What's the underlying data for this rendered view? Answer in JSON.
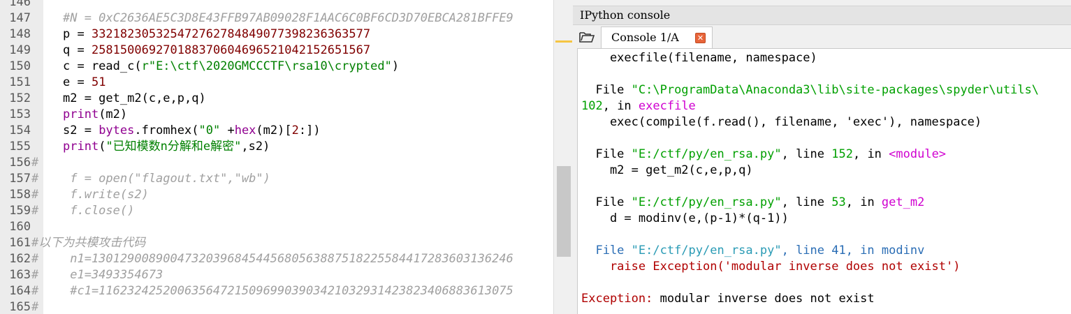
{
  "editor": {
    "lines": [
      {
        "num": "146",
        "fold": "",
        "tokens": []
      },
      {
        "num": "147",
        "fold": "",
        "tokens": [
          {
            "t": "#N = 0xC2636AE5C3D8E43FFB97AB09028F1AAC6C0BF6CD3D70EBCA281BFFE9",
            "c": "cmt"
          }
        ]
      },
      {
        "num": "148",
        "fold": "",
        "tokens": [
          {
            "t": "p = ",
            "c": "var"
          },
          {
            "t": "33218230532547276278484907739823636357​7",
            "c": "num"
          }
        ]
      },
      {
        "num": "149",
        "fold": "",
        "tokens": [
          {
            "t": "q = ",
            "c": "var"
          },
          {
            "t": "258150069270188370604696521042152651567",
            "c": "num"
          }
        ]
      },
      {
        "num": "150",
        "fold": "",
        "tokens": [
          {
            "t": "c = read_c(",
            "c": "var"
          },
          {
            "t": "r\"E:\\ctf\\2020GMCCCTF\\rsa10\\crypted\"",
            "c": "str"
          },
          {
            "t": ")",
            "c": "var"
          }
        ]
      },
      {
        "num": "151",
        "fold": "",
        "tokens": [
          {
            "t": "e = ",
            "c": "var"
          },
          {
            "t": "51",
            "c": "num"
          }
        ]
      },
      {
        "num": "152",
        "fold": "",
        "tokens": [
          {
            "t": "m2 = get_m2(c,e,p,q)",
            "c": "var"
          }
        ]
      },
      {
        "num": "153",
        "fold": "",
        "tokens": [
          {
            "t": "print",
            "c": "kw"
          },
          {
            "t": "(m2)",
            "c": "var"
          }
        ]
      },
      {
        "num": "154",
        "fold": "",
        "tokens": [
          {
            "t": "s2 = ",
            "c": "var"
          },
          {
            "t": "bytes",
            "c": "kw"
          },
          {
            "t": ".fromhex(",
            "c": "var"
          },
          {
            "t": "\"0\"",
            "c": "str"
          },
          {
            "t": " +",
            "c": "var"
          },
          {
            "t": "hex",
            "c": "kw"
          },
          {
            "t": "(m2)[",
            "c": "var"
          },
          {
            "t": "2",
            "c": "num"
          },
          {
            "t": ":])",
            "c": "var"
          }
        ]
      },
      {
        "num": "155",
        "fold": "",
        "tokens": [
          {
            "t": "print",
            "c": "kw"
          },
          {
            "t": "(",
            "c": "var"
          },
          {
            "t": "\"已知模数n分解和e解密\"",
            "c": "str"
          },
          {
            "t": ",s2)",
            "c": "var"
          }
        ]
      },
      {
        "num": "156",
        "fold": "#",
        "tokens": []
      },
      {
        "num": "157",
        "fold": "#",
        "tokens": [
          {
            "t": " f = open(\"flagout.txt\",\"wb\")",
            "c": "cmt"
          }
        ]
      },
      {
        "num": "158",
        "fold": "#",
        "tokens": [
          {
            "t": " f.write(s2)",
            "c": "cmt"
          }
        ]
      },
      {
        "num": "159",
        "fold": "#",
        "tokens": [
          {
            "t": " f.close()",
            "c": "cmt"
          }
        ]
      },
      {
        "num": "160",
        "fold": "",
        "tokens": []
      },
      {
        "num": "161",
        "fold": "#以下为共模攻击代码",
        "tokens": []
      },
      {
        "num": "162",
        "fold": "#",
        "tokens": [
          {
            "t": " n1=1301290089004732039684544568056388751822558441728360313624​6",
            "c": "cmt"
          }
        ]
      },
      {
        "num": "163",
        "fold": "#",
        "tokens": [
          {
            "t": " e1=3493354673",
            "c": "cmt"
          }
        ]
      },
      {
        "num": "164",
        "fold": "#",
        "tokens": [
          {
            "t": " #c1=1162324252006356472150969903903421032931423823406883613075",
            "c": "cmt"
          }
        ]
      },
      {
        "num": "165",
        "fold": "#",
        "tokens": []
      }
    ]
  },
  "ipython": {
    "title": "IPython console",
    "tab_label": "Console 1/A",
    "close_glyph": "✕",
    "lines": [
      [
        {
          "t": "    execfile(filename, namespace)",
          "c": ""
        }
      ],
      [],
      [
        {
          "t": "  File ",
          "c": ""
        },
        {
          "t": "\"C:\\ProgramData\\Anaconda3\\lib\\site-packages\\spyder\\utils\\",
          "c": "c-str"
        }
      ],
      [
        {
          "t": "102",
          "c": "c-ln"
        },
        {
          "t": ", in ",
          "c": ""
        },
        {
          "t": "execfile",
          "c": "c-fn"
        }
      ],
      [
        {
          "t": "    exec(compile(f.read(), filename, 'exec'), namespace)",
          "c": ""
        }
      ],
      [],
      [
        {
          "t": "  File ",
          "c": ""
        },
        {
          "t": "\"E:/ctf/py/en_rsa.py\"",
          "c": "c-str"
        },
        {
          "t": ", line ",
          "c": ""
        },
        {
          "t": "152",
          "c": "c-ln"
        },
        {
          "t": ", in ",
          "c": ""
        },
        {
          "t": "<module>",
          "c": "c-fn"
        }
      ],
      [
        {
          "t": "    m2 = get_m2(c,e,p,q)",
          "c": ""
        }
      ],
      [],
      [
        {
          "t": "  File ",
          "c": ""
        },
        {
          "t": "\"E:/ctf/py/en_rsa.py\"",
          "c": "c-str"
        },
        {
          "t": ", line ",
          "c": ""
        },
        {
          "t": "53",
          "c": "c-ln"
        },
        {
          "t": ", in ",
          "c": ""
        },
        {
          "t": "get_m2",
          "c": "c-fn"
        }
      ],
      [
        {
          "t": "    d = modinv(e,(p-1)*(q-1))",
          "c": ""
        }
      ],
      [],
      [
        {
          "t": "  File ",
          "c": "c-blue"
        },
        {
          "t": "\"E:/ctf/py/en_rsa.py\"",
          "c": "c-blue-str"
        },
        {
          "t": ", line 41, in ",
          "c": "c-blue"
        },
        {
          "t": "modinv",
          "c": "c-blue"
        }
      ],
      [
        {
          "t": "    raise Exception('modular inverse does not exist')",
          "c": "c-raise"
        }
      ],
      [],
      [
        {
          "t": "Exception:",
          "c": "c-exc"
        },
        {
          "t": " modular inverse does not exist",
          "c": ""
        }
      ]
    ]
  },
  "colors": {
    "number": "#800000",
    "string": "#008000",
    "builtin": "#900090",
    "comment": "#a0a0a0"
  }
}
